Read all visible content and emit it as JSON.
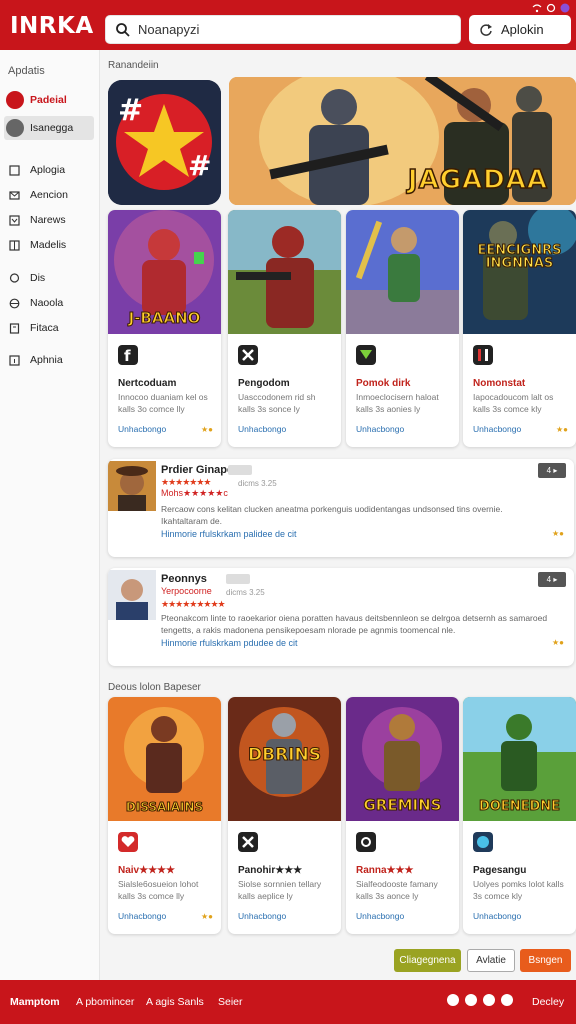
{
  "app": {
    "logo": "INRKA"
  },
  "search": {
    "value": "Noanapyzi"
  },
  "header": {
    "button_label": "Aplokin"
  },
  "colors": {
    "brand": "#c8151b",
    "accent_green": "#9aa322",
    "accent_orange": "#e85c1c"
  },
  "sidebar": {
    "heading": "Apdatis",
    "items": [
      {
        "label": "Padeial",
        "icon": "avatar-red"
      },
      {
        "label": "Isanegga",
        "icon": "avatar-dark"
      },
      {
        "label": "Aplogia",
        "icon": "square-icon"
      },
      {
        "label": "Aencion",
        "icon": "mail-icon"
      },
      {
        "label": "Narews",
        "icon": "chevron-icon"
      },
      {
        "label": "Madelis",
        "icon": "grid-icon"
      },
      {
        "label": "Dis",
        "icon": "chat-icon"
      },
      {
        "label": "Naoola",
        "icon": "globe-icon"
      },
      {
        "label": "Fitaca",
        "icon": "book-icon"
      },
      {
        "label": "Aphnia",
        "icon": "info-icon"
      }
    ]
  },
  "featured": {
    "section_title": "Ranandeiin",
    "banner_title": "JAGADAA"
  },
  "top_cards": [
    {
      "art_title": "J-BAANO",
      "name": "Nertcoduam",
      "desc": "Innocoo duaniam kel os kalls 3o comce lly",
      "link": "Unhacbongo",
      "badge": "★●",
      "name_color": "#111"
    },
    {
      "art_title": "",
      "name": "Pengodom",
      "desc": "Uasccodonem rid sh kalls 3s sonce ly",
      "link": "Unhacbongo",
      "badge": "",
      "name_color": "#111"
    },
    {
      "art_title": "",
      "name": "Pomok dirk",
      "desc": "Inmoeclocisern haloat kalls 3s aonies ly",
      "link": "Unhacbongo",
      "badge": "",
      "name_color": "#c0231c"
    },
    {
      "art_title": "EENCIGNRS INGNNAS",
      "name": "Nomonstat",
      "desc": "Iapocadoucom lalt os kalls 3s comce kly",
      "link": "Unhacbongo",
      "badge": "★●",
      "name_color": "#c0231c"
    }
  ],
  "reviews": [
    {
      "name": "Prdier Ginape",
      "date": "dicms 3.25",
      "stars": "★★★★★★★",
      "subtitle": "Mohs★★★★★c",
      "text": "Rercaow cons kelitan clucken aneatma porkenguis uodidentangas undsonsed tins overnie. Ikahtaltaram de.",
      "link": "Hinmorie rfulskrkam palidee de cit",
      "button": "4 ▸",
      "badge": "★●"
    },
    {
      "name": "Peonnys",
      "date": "dicms 3.25",
      "stars": "★★★★★★★★★",
      "subtitle": "Yerpocoorne",
      "text": "Pteonakcom linte to raoekarior oiena poratten havaus deitsbennleon se delrgoa detsernh as samaroed tengetts, a rakis madonena pensikepoesam nlorade pe agnmis toomencal nle.",
      "link": "Hinmorie rfulskrkam pdudee de cit",
      "button": "4 ▸",
      "badge": "★●"
    }
  ],
  "bottom_section": {
    "title": "Deous lolon Bapeser"
  },
  "bottom_cards": [
    {
      "art_title": "DISSAIAINS",
      "name": "Naiv★★★★",
      "desc": "Sialsle6osueion lohot kalls 3s comce lly",
      "link": "Unhacbongo",
      "badge": "★●"
    },
    {
      "art_title": "DBRINS",
      "name": "Panohir★★★",
      "desc": "Siolse sornnien tellary kalls aeplice ly",
      "link": "Unhacbongo",
      "badge": ""
    },
    {
      "art_title": "GREMINS",
      "name": "Ranna★★★",
      "desc": "Sialfeodooste famany kalls 3s aonce ly",
      "link": "Unhacbongo",
      "badge": ""
    },
    {
      "art_title": "DOENEDNE",
      "name": "Pagesangu",
      "desc": "Uolyes pomks lolot kalls 3s comce kly",
      "link": "Unhacbongo",
      "badge": ""
    }
  ],
  "actions": {
    "primary": "Cliagegnena",
    "secondary": "Avlatie",
    "tertiary": "Bsngen"
  },
  "footer": {
    "links": [
      "Mamptom",
      "A pbomincer",
      "A agis Sanls",
      "Seier"
    ],
    "right": "Decley"
  }
}
